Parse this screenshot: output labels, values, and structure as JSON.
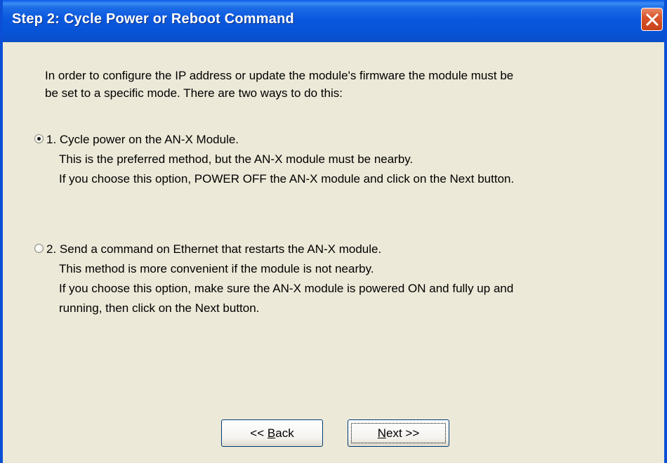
{
  "window": {
    "title": "Step 2: Cycle Power or Reboot Command"
  },
  "intro": {
    "line1": "In order to configure the IP address or update the module's firmware the module must be",
    "line2": "be set to a specific mode. There are two ways to do this:"
  },
  "options": [
    {
      "selected": true,
      "lines": [
        "1. Cycle power on the AN-X Module.",
        "This is the preferred method, but the AN-X module must be nearby.",
        "If you choose this option, POWER OFF the AN-X module and click on the Next button."
      ]
    },
    {
      "selected": false,
      "lines": [
        "2. Send a command on Ethernet that restarts the AN-X module.",
        "This method is more convenient if the module is not nearby.",
        "If you choose this option, make sure the AN-X module is powered ON and fully up and",
        "running, then click on the Next button."
      ]
    }
  ],
  "buttons": {
    "back_prefix": "<< ",
    "back_mnemonic": "B",
    "back_rest": "ack",
    "next_mnemonic": "N",
    "next_rest": "ext >>"
  },
  "colors": {
    "titlebar": "#0a58de",
    "window_border": "#0a4fd6",
    "dialog_background": "#ece9d8",
    "close_button": "#d9542c"
  },
  "icons": {
    "close": "close-icon"
  }
}
